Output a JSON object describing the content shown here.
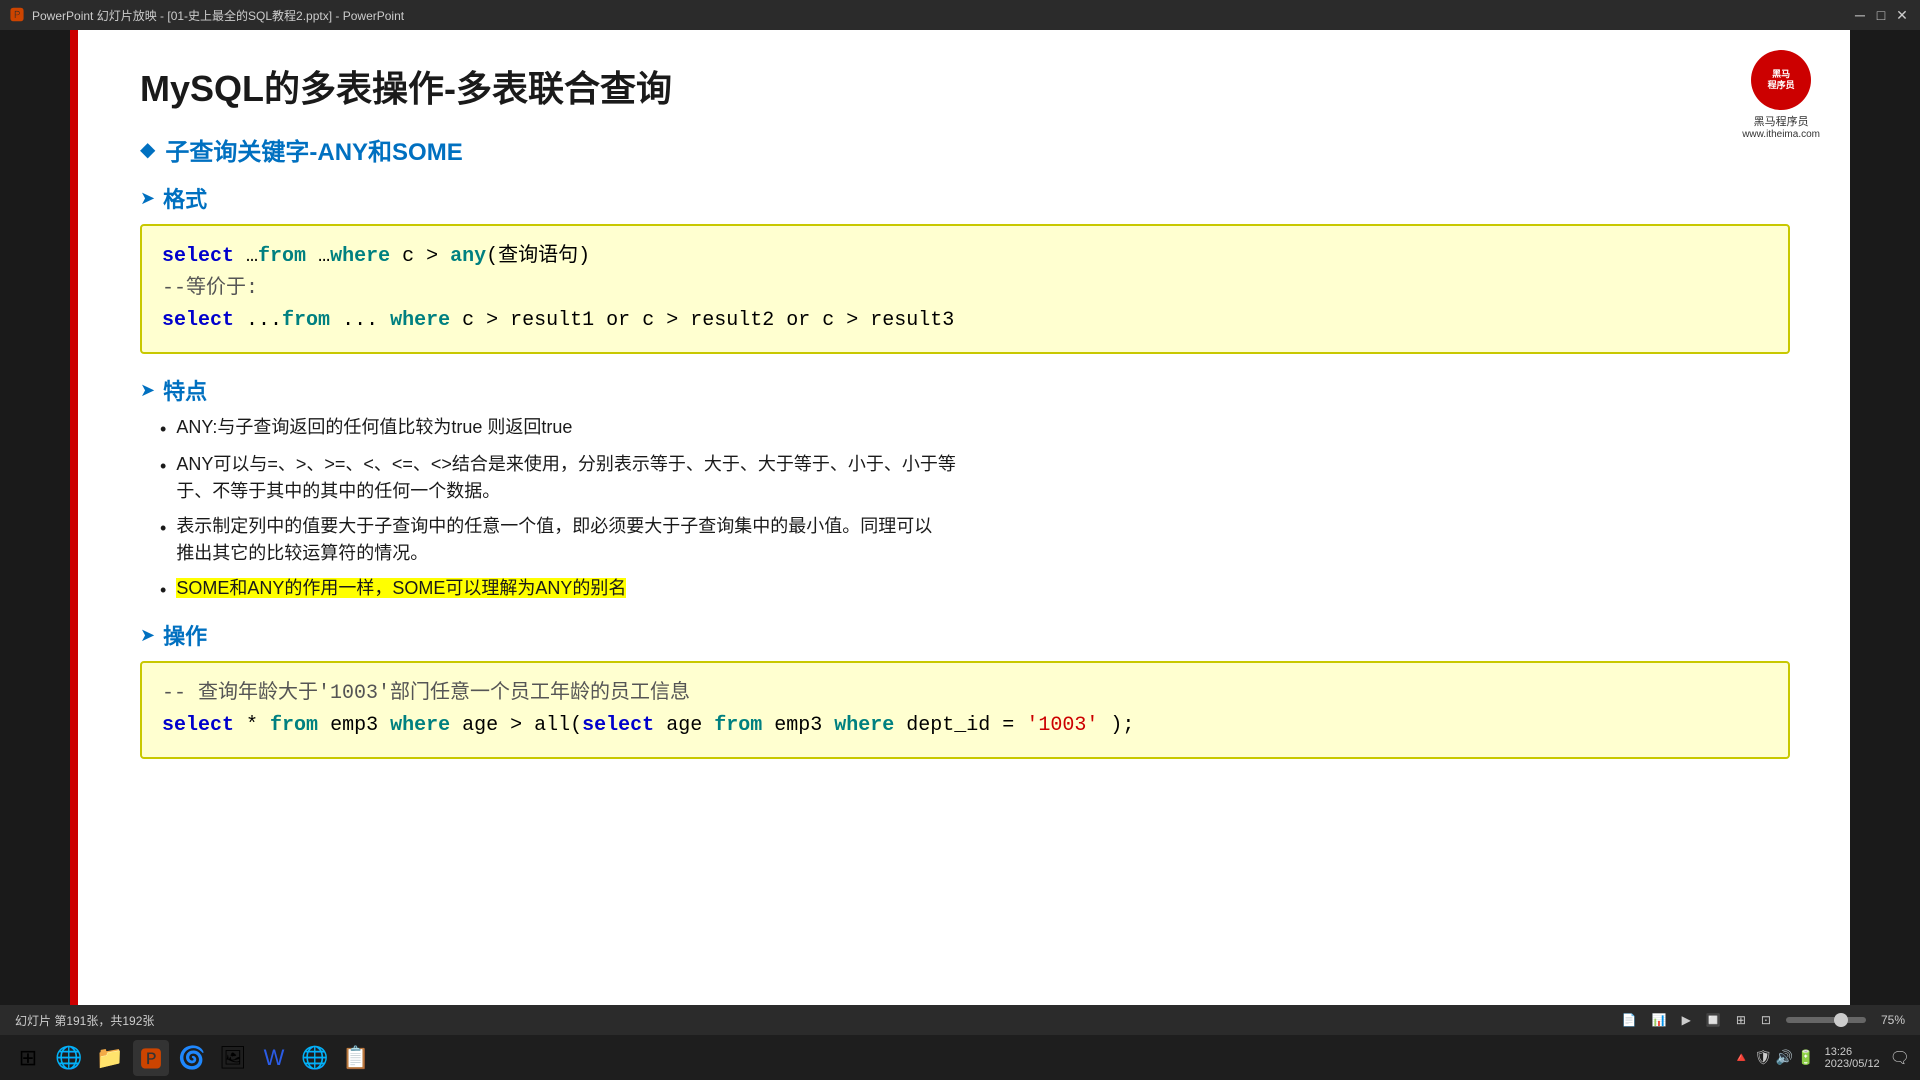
{
  "titlebar": {
    "icon": "🅿",
    "title": "PowerPoint 幻灯片放映 - [01-史上最全的SQL教程2.pptx] - PowerPoint",
    "minimize": "─",
    "maximize": "□",
    "close": "✕"
  },
  "logo": {
    "name": "黑马程序员",
    "url": "www.itheima.com"
  },
  "slide": {
    "title": "MySQL的多表操作-多表联合查询",
    "section_keyword": "子查询关键字-ANY和SOME",
    "format_label": "格式",
    "feature_label": "特点",
    "operation_label": "操作",
    "code1_line1": "select …from …where c > any(查询语句)",
    "code1_comment": "--等价于:",
    "code1_line2": "select ...from ... where c > result1 or c > result2 or c > result3",
    "bullets": [
      "ANY:与子查询返回的任何值比较为true 则返回true",
      "ANY可以与=、>、>=、<、<=、<>结合是来使用，分别表示等于、大于、大于等于、小于、小于等于于、不等于其中的其中的任何一个数据。",
      "表示制定列中的值要大于子查询中的任意一个值，即必须要大于子查询集中的最小值。同理可以推出其它的比较运算符的情况。",
      "SOME和ANY的作用一样，SOME可以理解为ANY的别名"
    ],
    "code2_comment": "-- 查询年龄大于'1003'部门任意一个员工年龄的员工信息",
    "code2_line": "select * from emp3 where age > all(select age from emp3 where dept_id = '1003');"
  },
  "statusbar": {
    "slide_info": "幻灯片 第191张，共192张",
    "view_icons": [
      "📄",
      "📊",
      "▶",
      "🔲",
      "⊞",
      "⊡"
    ]
  },
  "taskbar": {
    "icons": [
      "⊞",
      "🌐",
      "📁",
      "🅿",
      "🌀",
      "🖼",
      "W",
      "🌐",
      "📋"
    ],
    "time": "13:26",
    "date": "2023/05/12"
  }
}
